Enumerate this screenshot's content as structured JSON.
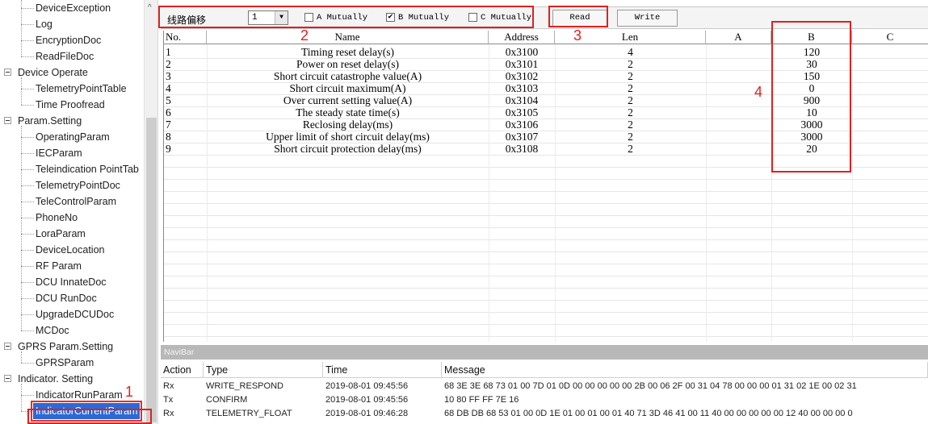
{
  "tree": {
    "items": [
      {
        "label": "DeviceException",
        "level": "child"
      },
      {
        "label": "Log",
        "level": "child"
      },
      {
        "label": "EncryptionDoc",
        "level": "child"
      },
      {
        "label": "ReadFileDoc",
        "level": "child"
      },
      {
        "label": "Device Operate",
        "level": "parent"
      },
      {
        "label": "TelemetryPointTable",
        "level": "child"
      },
      {
        "label": "Time Proofread",
        "level": "child"
      },
      {
        "label": "Param.Setting",
        "level": "parent"
      },
      {
        "label": "OperatingParam",
        "level": "child"
      },
      {
        "label": "IECParam",
        "level": "child"
      },
      {
        "label": "Teleindication PointTab",
        "level": "child"
      },
      {
        "label": "TelemetryPointDoc",
        "level": "child"
      },
      {
        "label": "TeleControlParam",
        "level": "child"
      },
      {
        "label": "PhoneNo",
        "level": "child"
      },
      {
        "label": "LoraParam",
        "level": "child"
      },
      {
        "label": "DeviceLocation",
        "level": "child"
      },
      {
        "label": "RF Param",
        "level": "child"
      },
      {
        "label": "DCU InnateDoc",
        "level": "child"
      },
      {
        "label": "DCU RunDoc",
        "level": "child"
      },
      {
        "label": "UpgradeDCUDoc",
        "level": "child"
      },
      {
        "label": "MCDoc",
        "level": "child"
      },
      {
        "label": "GPRS Param.Setting",
        "level": "parent"
      },
      {
        "label": "GPRSParam",
        "level": "child"
      },
      {
        "label": "Indicator. Setting",
        "level": "parent"
      },
      {
        "label": "IndicatorRunParam",
        "level": "child"
      },
      {
        "label": "IndicatorCurrentParam",
        "level": "child",
        "selected": true
      }
    ],
    "scroll_up_glyph": "^"
  },
  "toolbar": {
    "line_offset_label": "线路偏移",
    "line_select_value": "1",
    "dropdown_glyph": "▼",
    "check_a": {
      "label": "A Mutually",
      "checked": false
    },
    "check_b": {
      "label": "B Mutually",
      "checked": true
    },
    "check_c": {
      "label": "C Mutually",
      "checked": false
    },
    "read_label": "Read",
    "write_label": "Write"
  },
  "annotations": [
    "1",
    "2",
    "3",
    "4"
  ],
  "grid": {
    "headers": [
      "No.",
      "Name",
      "Address",
      "Len",
      "A",
      "B",
      "C"
    ],
    "rows": [
      [
        "1",
        "Timing reset delay(s)",
        "0x3100",
        "4",
        "",
        "120",
        ""
      ],
      [
        "2",
        "Power on reset delay(s)",
        "0x3101",
        "2",
        "",
        "30",
        ""
      ],
      [
        "3",
        "Short circuit catastrophe value(A)",
        "0x3102",
        "2",
        "",
        "150",
        ""
      ],
      [
        "4",
        "Short circuit maximum(A)",
        "0x3103",
        "2",
        "",
        "0",
        ""
      ],
      [
        "5",
        "Over current setting value(A)",
        "0x3104",
        "2",
        "",
        "900",
        ""
      ],
      [
        "6",
        "The steady state time(s)",
        "0x3105",
        "2",
        "",
        "10",
        ""
      ],
      [
        "7",
        "Reclosing delay(ms)",
        "0x3106",
        "2",
        "",
        "3000",
        ""
      ],
      [
        "8",
        "Upper limit of short circuit delay(ms)",
        "0x3107",
        "2",
        "",
        "3000",
        ""
      ],
      [
        "9",
        "Short circuit protection delay(ms)",
        "0x3108",
        "2",
        "",
        "20",
        ""
      ]
    ]
  },
  "navibar": {
    "title": "NaviBar",
    "headers": [
      "Action",
      "Type",
      "Time",
      "Message"
    ],
    "rows": [
      [
        "Rx",
        "WRITE_RESPOND",
        "2019-08-01 09:45:56",
        "68 3E 3E 68 73 01 00 7D 01 0D 00 00 00 00 00 2B 00 06 2F 00 31 04 78 00 00 00 01 31 02 1E 00 02 31"
      ],
      [
        "Tx",
        "CONFIRM",
        "2019-08-01 09:45:56",
        "10 80 FF FF 7E 16"
      ],
      [
        "Rx",
        "TELEMETRY_FLOAT",
        "2019-08-01 09:46:28",
        "68 DB DB 68 53 01 00 0D 1E 01 00 01 00 01 40 71 3D 46 41 00 11 40 00 00 00 00 00 12 40 00 00 00 0"
      ]
    ]
  }
}
